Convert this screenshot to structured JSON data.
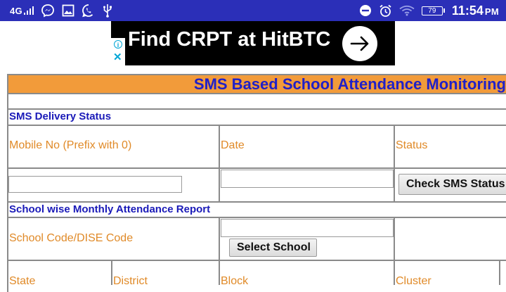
{
  "status_bar": {
    "network": "4G",
    "battery_level": "79",
    "time": "11:54",
    "time_suffix": "PM"
  },
  "ad": {
    "text": "Find CRPT at HitBTC",
    "info_symbol": "i",
    "close_symbol": "✕"
  },
  "page": {
    "title": "SMS Based School Attendance Monitoring",
    "sms_section": {
      "heading": "SMS Delivery Status",
      "col_mobile": "Mobile No (Prefix with 0)",
      "col_date": "Date",
      "col_status": "Status",
      "mobile_value": "",
      "date_value": "",
      "check_button": "Check SMS Status"
    },
    "report_section": {
      "heading": "School wise Monthly Attendance Report",
      "school_code_label": "School Code/DISE Code",
      "school_code_value": "",
      "select_button": "Select School",
      "col_state": "State",
      "col_district": "District",
      "col_block": "Block",
      "col_cluster": "Cluster"
    }
  },
  "colors": {
    "status_bar": "#2b2fb8",
    "title_bar": "#f29b3a",
    "heading_text": "#1a1ab8",
    "label_text": "#e08a28"
  }
}
